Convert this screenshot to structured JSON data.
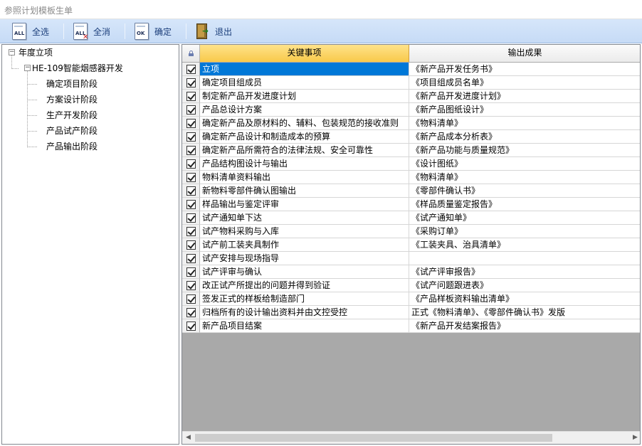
{
  "window": {
    "title": "参照计划模板生单"
  },
  "toolbar": {
    "select_all": {
      "icon": "select-all-doc-icon",
      "tag": "ALL",
      "label": "全选"
    },
    "deselect_all": {
      "icon": "deselect-all-doc-icon",
      "tag": "ALL",
      "label": "全消"
    },
    "confirm": {
      "icon": "confirm-doc-icon",
      "tag": "OK",
      "label": "确定"
    },
    "exit": {
      "icon": "exit-door-icon",
      "label": "退出"
    }
  },
  "tree": {
    "root": {
      "label": "年度立项",
      "expander": "−"
    },
    "project": {
      "label": "HE-109智能烟感器开发",
      "expander": "−"
    },
    "stages": [
      {
        "label": "确定项目阶段"
      },
      {
        "label": "方案设计阶段"
      },
      {
        "label": "生产开发阶段"
      },
      {
        "label": "产品试产阶段"
      },
      {
        "label": "产品输出阶段"
      }
    ]
  },
  "grid": {
    "columns": {
      "lock": "lock-icon",
      "key": "关键事项",
      "output": "输出成果"
    },
    "selected_row": 0,
    "rows": [
      {
        "checked": true,
        "key": "立项",
        "output": "《新产品开发任务书》"
      },
      {
        "checked": true,
        "key": "确定项目组成员",
        "output": "《项目组成员名单》"
      },
      {
        "checked": true,
        "key": "制定新产品开发进度计划",
        "output": "《新产品开发进度计划》"
      },
      {
        "checked": true,
        "key": "产品总设计方案",
        "output": "《新产品图纸设计》"
      },
      {
        "checked": true,
        "key": "确定新产品及原材料的、辅料、包装规范的接收准则",
        "output": "《物料清单》"
      },
      {
        "checked": true,
        "key": "确定新产品设计和制造成本的预算",
        "output": "《新产品成本分析表》"
      },
      {
        "checked": true,
        "key": "确定新产品所需符合的法律法规、安全可靠性",
        "output": "《新产品功能与质量规范》"
      },
      {
        "checked": true,
        "key": "产品结构图设计与输出",
        "output": "《设计图纸》"
      },
      {
        "checked": true,
        "key": "物料清单资料输出",
        "output": "《物料清单》"
      },
      {
        "checked": true,
        "key": "新物料零部件确认图输出",
        "output": "《零部件确认书》"
      },
      {
        "checked": true,
        "key": "样品输出与鉴定评审",
        "output": "《样品质量鉴定报告》"
      },
      {
        "checked": true,
        "key": "试产通知单下达",
        "output": "《试产通知单》"
      },
      {
        "checked": true,
        "key": "试产物料采购与入库",
        "output": "《采购订单》"
      },
      {
        "checked": true,
        "key": "试产前工装夹具制作",
        "output": "《工装夹具、治具清单》"
      },
      {
        "checked": true,
        "key": "试产安排与现场指导",
        "output": ""
      },
      {
        "checked": true,
        "key": "试产评审与确认",
        "output": "《试产评审报告》"
      },
      {
        "checked": true,
        "key": "改正试产所提出的问题并得到验证",
        "output": "《试产问题跟进表》"
      },
      {
        "checked": true,
        "key": "签发正式的样板给制造部门",
        "output": "《产品样板资料输出清单》"
      },
      {
        "checked": true,
        "key": "归档所有的设计输出资料并由文控受控",
        "output": "正式《物料清单》、《零部件确认书》发版"
      },
      {
        "checked": true,
        "key": "新产品项目结案",
        "output": "《新产品开发结案报告》"
      }
    ]
  },
  "scrollbar": {
    "left_arrow": "◀",
    "right_arrow": "▶"
  }
}
